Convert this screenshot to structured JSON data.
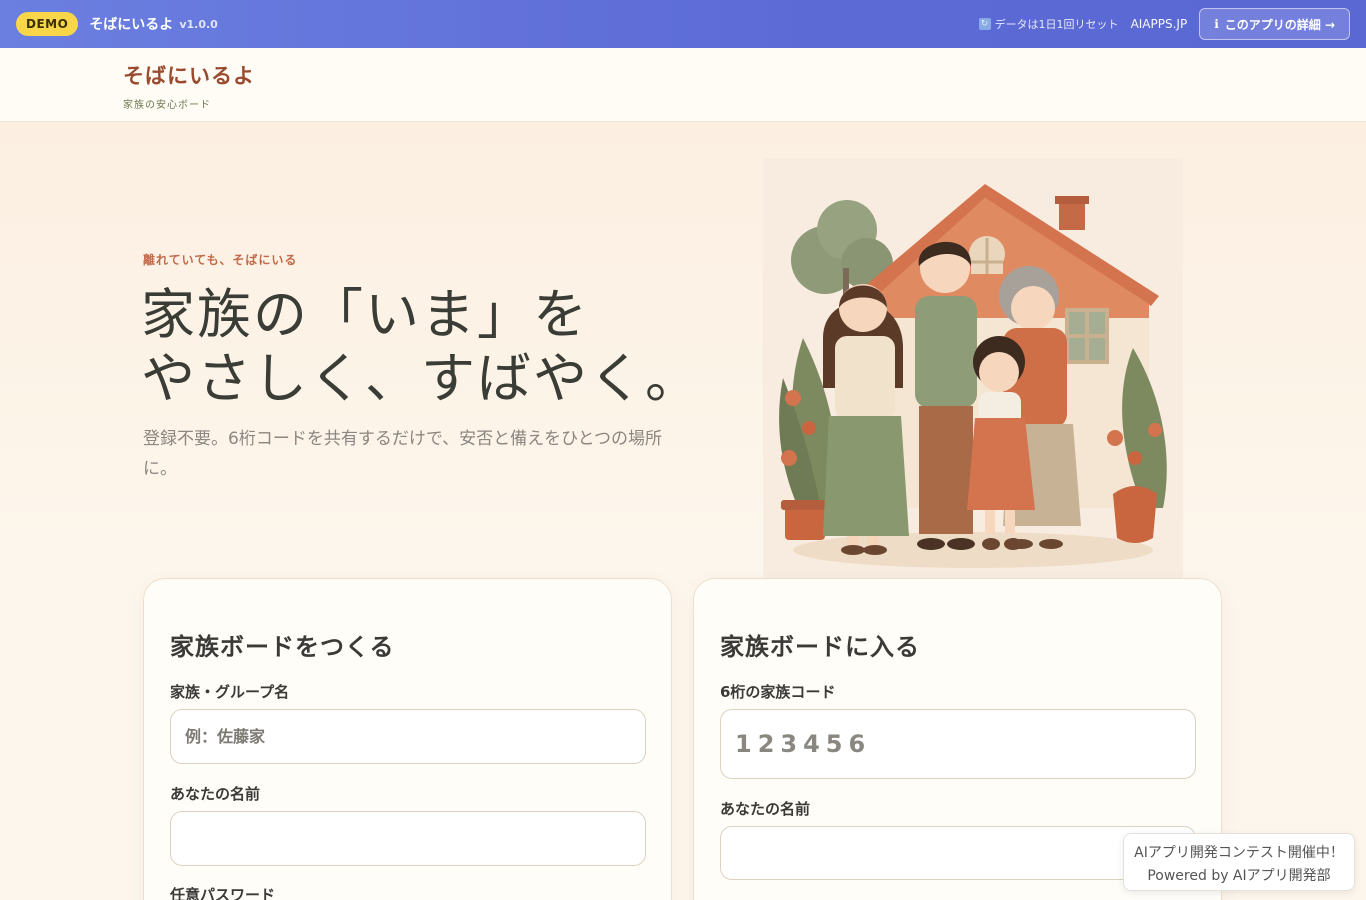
{
  "topbar": {
    "badge": "DEMO",
    "app_name": "そばにいるよ",
    "version": "v1.0.0",
    "reset_icon": "refresh-icon",
    "reset_note": "データは1日1回リセット",
    "site_link": "AIAPPS.JP",
    "details_icon": "info-icon",
    "details_label": "このアプリの詳細 →",
    "colors": {
      "gradient_start": "#6b7fe0",
      "gradient_end": "#5a68d4",
      "badge": "#f7d64a"
    }
  },
  "header": {
    "brand_name": "そばにいるよ",
    "brand_sub": "家族の安心ボード",
    "brand_color": "#9a4a2e"
  },
  "hero": {
    "eyebrow": "離れていても、そばにいる",
    "headline_line1": "家族の「いま」を",
    "headline_line2": "やさしく、すばやく。",
    "lead": "登録不要。6桁コードを共有するだけで、安否と備えをひとつの場所に。",
    "illustration": "family-house-illustration"
  },
  "create_card": {
    "title": "家族ボードをつくる",
    "group_label": "家族・グループ名",
    "group_placeholder": "例：佐藤家",
    "name_label": "あなたの名前",
    "name_value": "",
    "password_label": "任意パスワード"
  },
  "join_card": {
    "title": "家族ボードに入る",
    "code_label": "6桁の家族コード",
    "code_placeholder": "123456",
    "name_label": "あなたの名前",
    "name_value": ""
  },
  "toast": {
    "line1": "AIアプリ開発コンテスト開催中！",
    "line2": "Powered by AIアプリ開発部"
  }
}
